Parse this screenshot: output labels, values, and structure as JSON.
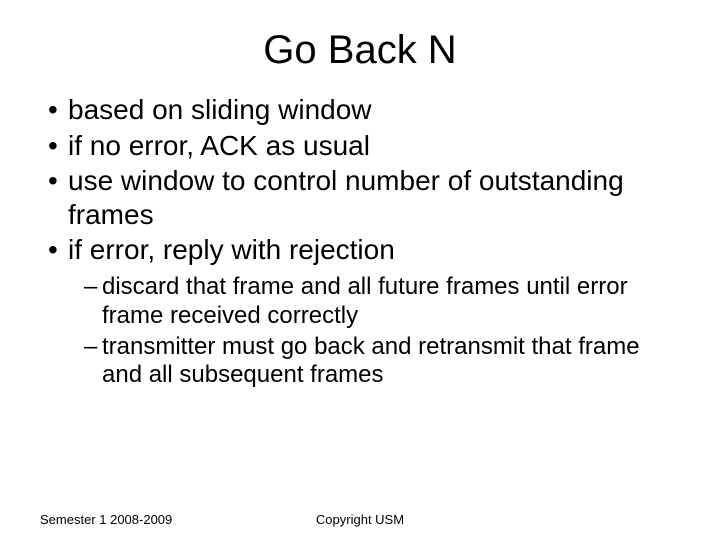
{
  "title": "Go Back N",
  "bullets": [
    "based on sliding window",
    "if no error, ACK as usual",
    "use window to control number of outstanding frames",
    "if error, reply with rejection"
  ],
  "sub_bullets": [
    "discard that frame and all future frames until error frame received correctly",
    "transmitter must go back and retransmit that frame and all subsequent frames"
  ],
  "footer": {
    "left": "Semester 1 2008-2009",
    "center": "Copyright USM"
  }
}
